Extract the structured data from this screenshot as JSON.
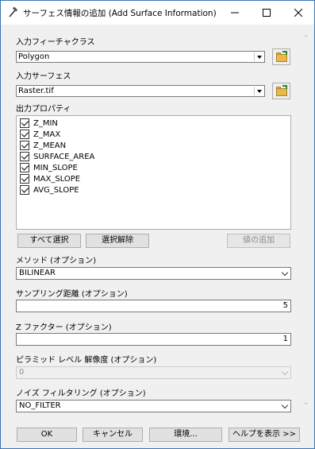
{
  "window": {
    "title": "サーフェス情報の追加 (Add Surface Information)"
  },
  "input_features": {
    "label": "入力フィーチャクラス",
    "value": "Polygon"
  },
  "input_surface": {
    "label": "入力サーフェス",
    "value": "Raster.tif"
  },
  "output_properties": {
    "label": "出力プロパティ",
    "items": [
      {
        "label": "Z_MIN",
        "checked": true
      },
      {
        "label": "Z_MAX",
        "checked": true
      },
      {
        "label": "Z_MEAN",
        "checked": true
      },
      {
        "label": "SURFACE_AREA",
        "checked": true
      },
      {
        "label": "MIN_SLOPE",
        "checked": true
      },
      {
        "label": "MAX_SLOPE",
        "checked": true
      },
      {
        "label": "AVG_SLOPE",
        "checked": true
      }
    ],
    "select_all": "すべて選択",
    "clear_selection": "選択解除",
    "add_value": "値の追加"
  },
  "method": {
    "label": "メソッド (オプション)",
    "value": "BILINEAR"
  },
  "sample_distance": {
    "label": "サンプリング距離 (オプション)",
    "value": "5"
  },
  "z_factor": {
    "label": "Z ファクター (オプション)",
    "value": "1"
  },
  "pyramid": {
    "label": "ピラミッド レベル 解像度 (オプション)",
    "value": "0"
  },
  "noise_filter": {
    "label": "ノイズ フィルタリング (オプション)",
    "value": "NO_FILTER"
  },
  "footer": {
    "ok": "OK",
    "cancel": "キャンセル",
    "environments": "環境...",
    "show_help": "ヘルプを表示 >>"
  },
  "icons": {
    "app": "tool-hammer-icon",
    "minimize": "minimize-icon",
    "maximize": "maximize-icon",
    "close": "close-icon",
    "browse": "folder-open-icon"
  }
}
